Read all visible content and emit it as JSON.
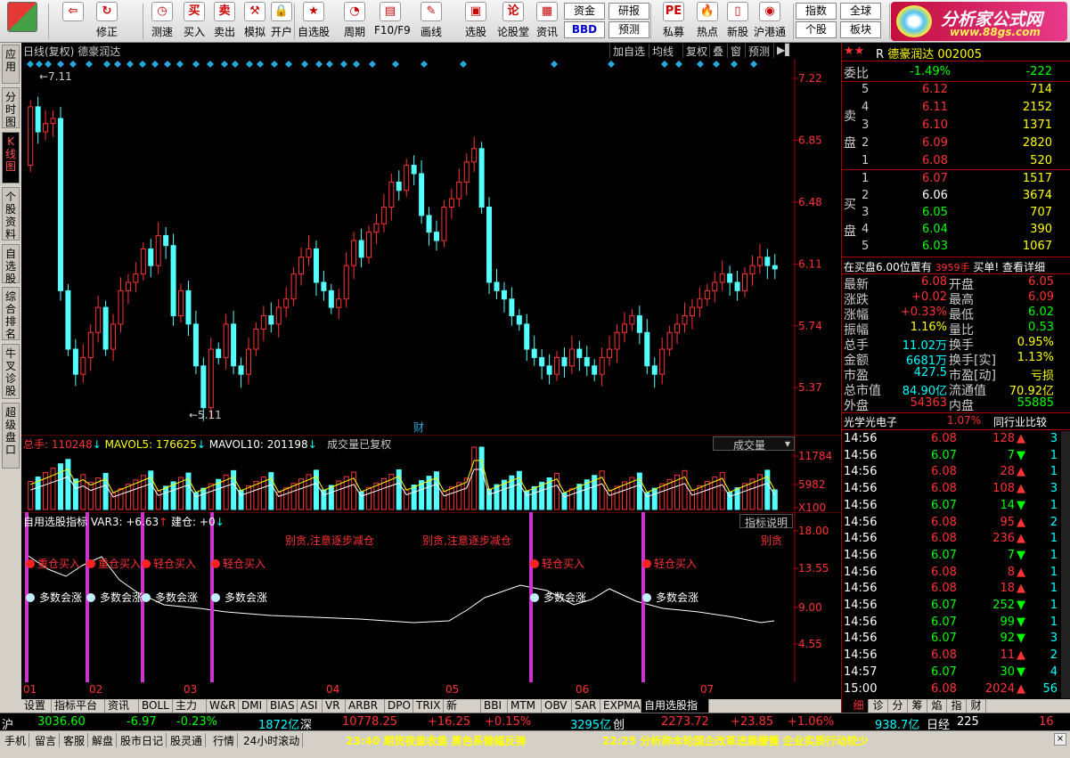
{
  "toolbar": {
    "buttons": [
      {
        "name": "back",
        "label": "",
        "icon": "back-arrow-icon",
        "glyph": "⇦"
      },
      {
        "name": "revise",
        "label": "修正",
        "icon": "refresh-icon",
        "glyph": "↻"
      },
      {
        "name": "speedtest",
        "label": "测速",
        "icon": "clock-icon",
        "glyph": "◷"
      },
      {
        "name": "buy",
        "label": "买入",
        "icon": "buy-icon",
        "glyph": "买"
      },
      {
        "name": "sell",
        "label": "卖出",
        "icon": "sell-icon",
        "glyph": "卖"
      },
      {
        "name": "simulate",
        "label": "模拟",
        "icon": "hammer-icon",
        "glyph": "⚒"
      },
      {
        "name": "open-account",
        "label": "开户",
        "icon": "lock-icon",
        "glyph": "🔒"
      },
      {
        "name": "watchlist",
        "label": "自选股",
        "icon": "star-icon",
        "glyph": "★"
      },
      {
        "name": "period",
        "label": "周期",
        "icon": "period-icon",
        "glyph": "◔"
      },
      {
        "name": "f10",
        "label": "F10/F9",
        "icon": "f10-icon",
        "glyph": "▤"
      },
      {
        "name": "draw",
        "label": "画线",
        "icon": "pencil-icon",
        "glyph": "✎"
      },
      {
        "name": "pick",
        "label": "选股",
        "icon": "screen-icon",
        "glyph": "▣"
      },
      {
        "name": "forum",
        "label": "论股堂",
        "icon": "forum-icon",
        "glyph": "论"
      },
      {
        "name": "info",
        "label": "资讯",
        "icon": "info-icon",
        "glyph": "▦"
      },
      {
        "name": "pe",
        "label": "私募",
        "icon": "pe-icon",
        "glyph": "PE"
      },
      {
        "name": "hot",
        "label": "热点",
        "icon": "hot-icon",
        "glyph": "🔥"
      },
      {
        "name": "newstock",
        "label": "新股",
        "icon": "doc-icon",
        "glyph": "▯"
      },
      {
        "name": "hk",
        "label": "沪港通",
        "icon": "hk-icon",
        "glyph": "◉"
      }
    ],
    "small": [
      "资金",
      "研报",
      "BBD",
      "预测",
      "指数",
      "全球",
      "个股",
      "板块"
    ]
  },
  "logo": {
    "title": "分析家公式网",
    "url": "www.88gs.com"
  },
  "left_tabs": [
    "应用",
    "分时图",
    "K线图",
    "个股资料",
    "自选股",
    "综合排名",
    "牛叉诊股",
    "超级盘口"
  ],
  "chart": {
    "title": "日线(复权)",
    "stock": "德豪润达",
    "tabs": [
      "加自选",
      "均线",
      "复权",
      "叠",
      "窗",
      "预测",
      "▶▌"
    ],
    "price_ticks": [
      "7.22",
      "6.85",
      "6.48",
      "6.11",
      "5.74",
      "5.37"
    ],
    "high_label": "7.11",
    "low_label": "5.11",
    "cai_label": "财",
    "vol_legend": {
      "total_label": "总手:",
      "total": "110248",
      "mavol5_label": "MAVOL5:",
      "mavol5": "176625",
      "mavol10_label": "MAVOL10:",
      "mavol10": "201198",
      "note": "成交量已复权"
    },
    "vol_select": "成交量",
    "vol_ticks": [
      "11784",
      "5982",
      "X100"
    ],
    "ind_legend": {
      "name": "自用选股指标",
      "var_label": "VAR3:",
      "var": "+6.63",
      "pos_label": "建仓:",
      "pos": "+0"
    },
    "ind_button": "指标说明",
    "ind_ticks": [
      "18.00",
      "13.55",
      "9.00",
      "4.55"
    ],
    "sig_buy_heavy": "重仓买入",
    "sig_buy_light": "轻仓买入",
    "sig_bull": "多数会涨",
    "sig_warn": "别贪,注意逐步减仓",
    "sig_warn_short": "别贪",
    "months": [
      "01",
      "02",
      "03",
      "04",
      "05",
      "06",
      "07"
    ],
    "bottom_tabs": [
      "设置",
      "指标平台",
      "资讯",
      "BOLL",
      "主力",
      "W&R",
      "DMI",
      "BIAS",
      "ASI",
      "VR",
      "ARBR",
      "DPO",
      "TRIX",
      "新DMA",
      "BBI",
      "MTM",
      "OBV",
      "SAR",
      "EXPMA",
      "自用选股指标"
    ]
  },
  "chart_data": {
    "type": "candlestick",
    "ylim": [
      5.11,
      7.22
    ],
    "closes": [
      7.05,
      6.9,
      6.95,
      6.98,
      5.95,
      5.6,
      5.45,
      5.55,
      5.7,
      5.85,
      5.6,
      5.75,
      5.95,
      6.0,
      6.05,
      6.2,
      6.1,
      6.28,
      6.22,
      5.8,
      5.95,
      5.75,
      5.5,
      5.25,
      5.6,
      5.55,
      5.75,
      5.5,
      5.45,
      5.6,
      5.72,
      5.8,
      5.75,
      5.85,
      5.9,
      6.05,
      6.15,
      6.2,
      6.0,
      5.95,
      5.85,
      5.9,
      6.1,
      6.25,
      6.15,
      6.3,
      6.35,
      6.45,
      6.6,
      6.55,
      6.7,
      6.65,
      6.4,
      6.3,
      6.25,
      6.45,
      6.5,
      6.6,
      6.72,
      6.8,
      6.45,
      6.0,
      5.95,
      5.9,
      5.8,
      5.75,
      5.6,
      5.55,
      5.5,
      5.45,
      5.55,
      5.5,
      5.6,
      5.55,
      5.5,
      5.45,
      5.55,
      5.6,
      5.7,
      5.75,
      5.8,
      5.7,
      5.5,
      5.45,
      5.6,
      5.7,
      5.75,
      5.8,
      5.85,
      5.9,
      5.95,
      6.0,
      6.05,
      6.0,
      5.95,
      6.05,
      6.1,
      6.15,
      6.1,
      6.08
    ],
    "volume_ticks": [
      11784,
      5982
    ],
    "indicator": {
      "name": "自用选股指标",
      "VAR3": 6.63,
      "建仓": 0,
      "ylim": [
        4.55,
        18.0
      ]
    },
    "signals_x_index": [
      0,
      6,
      12,
      18,
      57,
      67
    ]
  },
  "quote": {
    "stock_name": "德豪润达",
    "stock_code": "002005",
    "r_label": "R",
    "weibi_label": "委比",
    "weibi": "-1.49%",
    "weicha": "-222",
    "sell_label": "卖盘",
    "buy_label": "买盘",
    "asks": [
      {
        "lvl": "5",
        "price": "6.12",
        "vol": "714"
      },
      {
        "lvl": "4",
        "price": "6.11",
        "vol": "2152"
      },
      {
        "lvl": "3",
        "price": "6.10",
        "vol": "1371"
      },
      {
        "lvl": "2",
        "price": "6.09",
        "vol": "2820"
      },
      {
        "lvl": "1",
        "price": "6.08",
        "vol": "520"
      }
    ],
    "bids": [
      {
        "lvl": "1",
        "price": "6.07",
        "vol": "1517"
      },
      {
        "lvl": "2",
        "price": "6.06",
        "vol": "3674"
      },
      {
        "lvl": "3",
        "price": "6.05",
        "vol": "707"
      },
      {
        "lvl": "4",
        "price": "6.04",
        "vol": "390"
      },
      {
        "lvl": "5",
        "price": "6.03",
        "vol": "1067"
      }
    ],
    "notice": "在买盘6.00位置有",
    "notice_vol": "3959手",
    "notice_tail": "买单! 查看详细",
    "stats": [
      [
        "最新",
        "6.08",
        "开盘",
        "6.05"
      ],
      [
        "涨跌",
        "+0.02",
        "最高",
        "6.09"
      ],
      [
        "涨幅",
        "+0.33%",
        "最低",
        "6.02"
      ],
      [
        "振幅",
        "1.16%",
        "量比",
        "0.53"
      ],
      [
        "总手",
        "11.02万",
        "换手",
        "0.95%"
      ],
      [
        "金额",
        "6681万",
        "换手[实]",
        "1.13%"
      ],
      [
        "市盈",
        "427.5",
        "市盈[动]",
        "亏损"
      ],
      [
        "总市值",
        "84.90亿",
        "流通值",
        "70.92亿"
      ],
      [
        "外盘",
        "54363",
        "内盘",
        "55885"
      ]
    ],
    "industry": "光学光电子",
    "industry_pct": "1.07%",
    "industry_btn": "同行业比较",
    "ticks": [
      [
        "14:56",
        "6.08",
        "128",
        "up",
        "3"
      ],
      [
        "14:56",
        "6.07",
        "7",
        "down",
        "1"
      ],
      [
        "14:56",
        "6.08",
        "28",
        "up",
        "1"
      ],
      [
        "14:56",
        "6.08",
        "108",
        "up",
        "3"
      ],
      [
        "14:56",
        "6.07",
        "14",
        "down",
        "1"
      ],
      [
        "14:56",
        "6.08",
        "95",
        "up",
        "2"
      ],
      [
        "14:56",
        "6.08",
        "236",
        "up",
        "1"
      ],
      [
        "14:56",
        "6.07",
        "7",
        "down",
        "1"
      ],
      [
        "14:56",
        "6.08",
        "8",
        "up",
        "1"
      ],
      [
        "14:56",
        "6.08",
        "18",
        "up",
        "1"
      ],
      [
        "14:56",
        "6.07",
        "252",
        "down",
        "1"
      ],
      [
        "14:56",
        "6.07",
        "99",
        "down",
        "1"
      ],
      [
        "14:56",
        "6.07",
        "92",
        "down",
        "3"
      ],
      [
        "14:56",
        "6.08",
        "11",
        "up",
        "2"
      ],
      [
        "14:57",
        "6.07",
        "30",
        "down",
        "4"
      ],
      [
        "15:00",
        "6.08",
        "2024",
        "up",
        "56"
      ]
    ],
    "right_tabs": [
      "细",
      "诊",
      "分",
      "筹",
      "焰",
      "指",
      "财"
    ]
  },
  "status": {
    "sh_label": "沪",
    "sh_idx": "3036.60",
    "sh_chg": "-6.97",
    "sh_pct": "-0.23%",
    "sh_amt": "1872亿",
    "sz_label": "深",
    "sz_idx": "10778.25",
    "sz_chg": "+16.25",
    "sz_pct": "+0.15%",
    "sz_amt": "3295亿",
    "cy_label": "创",
    "cy_idx": "2273.72",
    "cy_chg": "+23.85",
    "cy_pct": "+1.06%",
    "cy_amt": "938.7亿",
    "rj_label": "日经",
    "rj_val": "225",
    "right_num": "16"
  },
  "news_bar": {
    "items": [
      "手机",
      "留言",
      "客服",
      "解盘",
      "股市日记",
      "股灵通",
      "行情",
      "24小时滚动"
    ],
    "news1": "23:40 期货夜盘收盘 黑色系微幅反弹",
    "news2": "22:25 分析称本轮国企改革进展缓慢 企业实质行动较少"
  },
  "colors": {
    "up": "#ff3333",
    "down": "#54ffff",
    "axis": "#aa0000",
    "signal": "#cc33cc"
  }
}
